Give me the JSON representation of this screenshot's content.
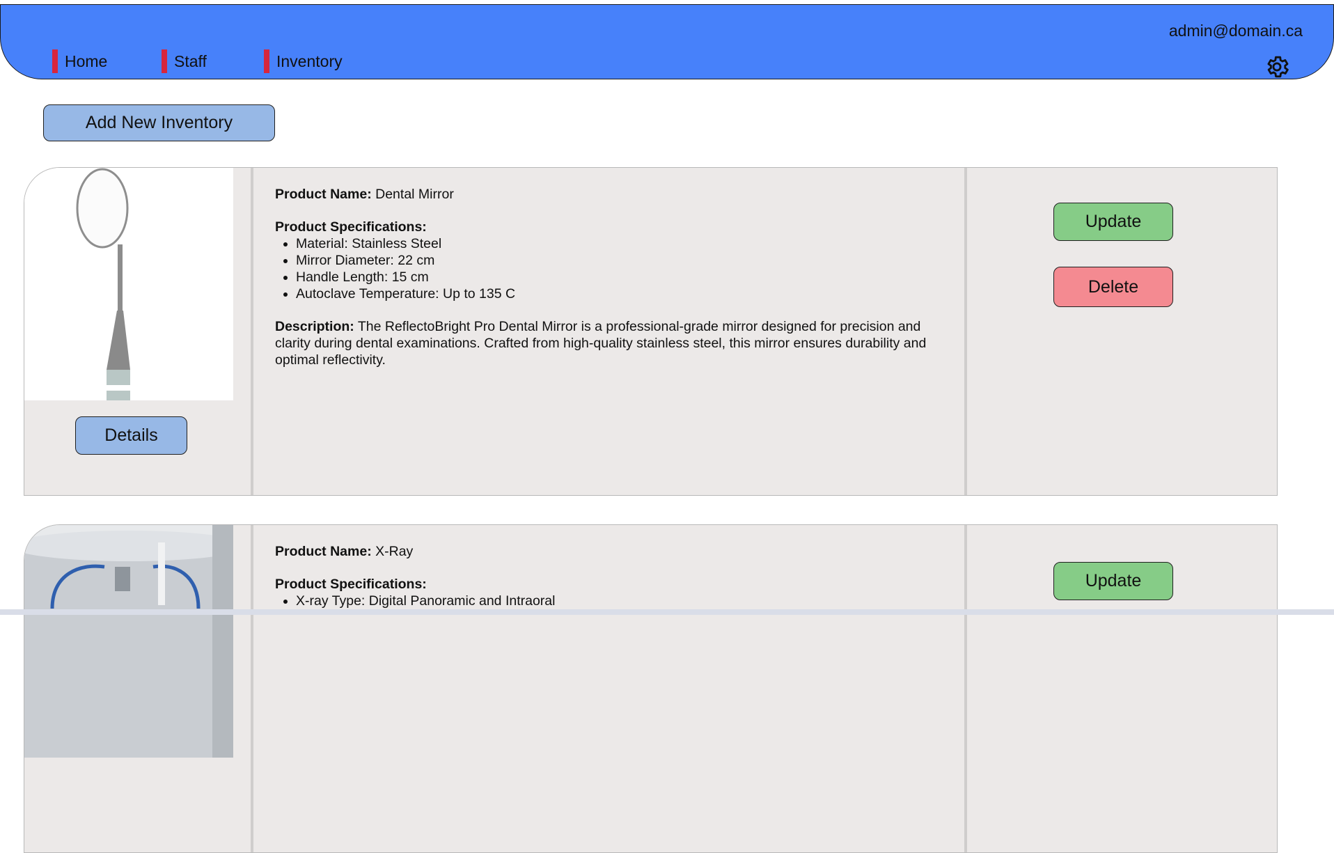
{
  "header": {
    "user_email": "admin@domain.ca",
    "nav": [
      {
        "label": "Home"
      },
      {
        "label": "Staff"
      },
      {
        "label": "Inventory"
      }
    ],
    "settings_icon": "gear-icon",
    "accent_color": "#4781fa",
    "nav_marker_color": "#d7263d"
  },
  "actions": {
    "add_label": "Add New Inventory"
  },
  "products": [
    {
      "name_label": "Product Name:",
      "name": "Dental Mirror",
      "specs_label": "Product Specifications:",
      "specs": [
        "Material: Stainless Steel",
        "Mirror Diameter: 22 cm",
        "Handle Length: 15 cm",
        "Autoclave Temperature: Up to 135 C"
      ],
      "desc_label": "Description:",
      "description": "The ReflectoBright Pro Dental Mirror is a professional-grade mirror designed for precision and clarity during dental examinations. Crafted from high-quality stainless steel, this mirror ensures durability and optimal reflectivity.",
      "details_label": "Details",
      "update_label": "Update",
      "delete_label": "Delete"
    },
    {
      "name_label": "Product Name:",
      "name": "X-Ray",
      "specs_label": "Product Specifications:",
      "specs": [
        "X-ray Type: Digital Panoramic and Intraoral"
      ],
      "update_label": "Update"
    }
  ]
}
